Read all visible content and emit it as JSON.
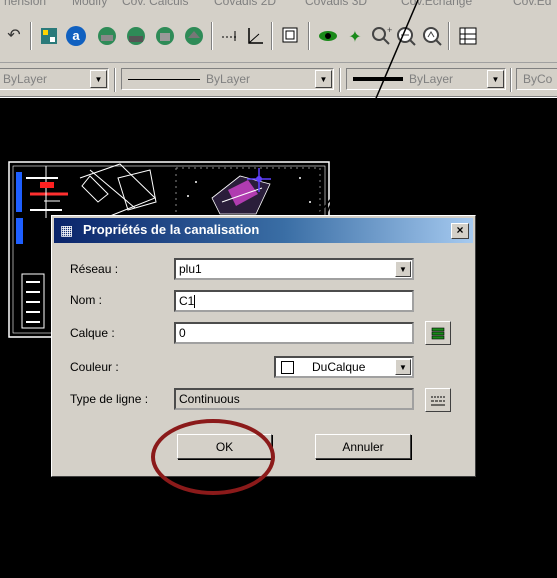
{
  "menubar": {
    "items": [
      "nension",
      "Modify",
      "Cov. Calculs",
      "Covadis 2D",
      "Covadis 3D",
      "Cov.Echange",
      "Cov.Ed"
    ]
  },
  "toolbar": {
    "icons": [
      "undo-arrow-icon",
      "layer-manager-icon",
      "covadis-a-icon",
      "globe-tool-icon",
      "globe-print-icon",
      "globe-settings-icon",
      "globe-house-icon",
      "dimension-icon",
      "ucs-icon",
      "zoom-window-icon",
      "orbit-eye-icon",
      "pan-hand-icon",
      "zoom-realtime-icon",
      "zoom-previous-icon",
      "zoom-extents-icon",
      "grid-icon"
    ]
  },
  "props": {
    "layer_combo": "ByLayer",
    "linetype_combo": "ByLayer",
    "lineweight_combo": "ByLayer",
    "color_combo": "ByCo"
  },
  "dialog": {
    "title": "Propriétés de la canalisation",
    "close_label": "×",
    "labels": {
      "reseau": "Réseau :",
      "nom": "Nom :",
      "calque": "Calque :",
      "couleur": "Couleur :",
      "type_ligne": "Type de ligne :"
    },
    "values": {
      "reseau": "plu1",
      "nom": "C1",
      "calque": "0",
      "couleur": "DuCalque",
      "type_ligne": "Continuous"
    },
    "buttons": {
      "ok": "OK",
      "cancel": "Annuler"
    }
  },
  "colors": {
    "annotation_circle": "#8b1a1a",
    "titlebar_start": "#0a246a",
    "drawing_background": "#000000"
  }
}
